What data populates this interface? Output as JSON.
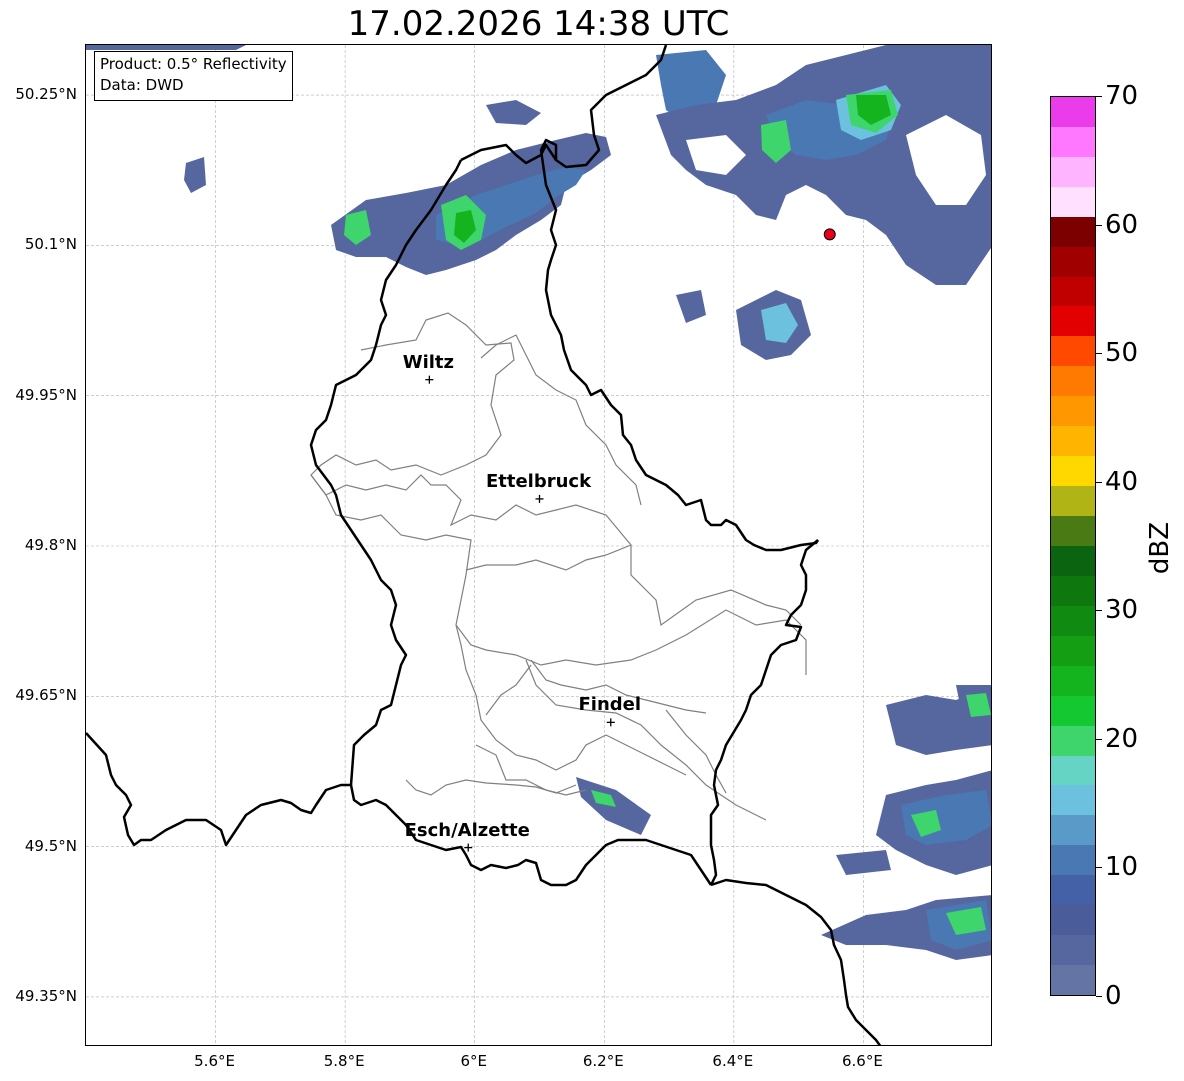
{
  "title": "17.02.2026 14:38 UTC",
  "info_box": {
    "product": "Product: 0.5° Reflectivity",
    "data": "Data: DWD"
  },
  "map": {
    "extent": {
      "lon_min": 5.4,
      "lon_max": 6.8,
      "lat_min": 49.3,
      "lat_max": 50.3
    },
    "lat_ticks": [
      {
        "value": 50.25,
        "label": "50.25°N"
      },
      {
        "value": 50.1,
        "label": "50.1°N"
      },
      {
        "value": 49.95,
        "label": "49.95°N"
      },
      {
        "value": 49.8,
        "label": "49.8°N"
      },
      {
        "value": 49.65,
        "label": "49.65°N"
      },
      {
        "value": 49.5,
        "label": "49.5°N"
      },
      {
        "value": 49.35,
        "label": "49.35°N"
      }
    ],
    "lon_ticks": [
      {
        "value": 5.6,
        "label": "5.6°E"
      },
      {
        "value": 5.8,
        "label": "5.8°E"
      },
      {
        "value": 6.0,
        "label": "6°E"
      },
      {
        "value": 6.2,
        "label": "6.2°E"
      },
      {
        "value": 6.4,
        "label": "6.4°E"
      },
      {
        "value": 6.6,
        "label": "6.6°E"
      }
    ],
    "cities": [
      {
        "name": "Wiltz",
        "lon": 5.93,
        "lat": 49.966
      },
      {
        "name": "Ettelbruck",
        "lon": 6.1,
        "lat": 49.847
      },
      {
        "name": "Findel",
        "lon": 6.21,
        "lat": 49.624
      },
      {
        "name": "Esch/Alzette",
        "lon": 5.99,
        "lat": 49.499
      }
    ],
    "radar_site": {
      "lon": 6.548,
      "lat": 50.111,
      "color": "#e8001a"
    },
    "border_color": "#000000",
    "canton_color": "#808080",
    "grid_color": "#b0b0b0"
  },
  "colorbar": {
    "label": "dBZ",
    "min": 0,
    "max": 70,
    "ticks": [
      {
        "value": 0,
        "label": "0"
      },
      {
        "value": 10,
        "label": "10"
      },
      {
        "value": 20,
        "label": "20"
      },
      {
        "value": 30,
        "label": "30"
      },
      {
        "value": 40,
        "label": "40"
      },
      {
        "value": 50,
        "label": "50"
      },
      {
        "value": 60,
        "label": "60"
      },
      {
        "value": 70,
        "label": "70"
      }
    ],
    "colors": [
      "#6474a4",
      "#56669e",
      "#4a5d9a",
      "#4460a6",
      "#4a78b2",
      "#5a9ac8",
      "#6cc2de",
      "#66d4c4",
      "#3ed66c",
      "#14c832",
      "#14b41e",
      "#149e14",
      "#108a10",
      "#0e780e",
      "#0a6410",
      "#4a7a14",
      "#b0b414",
      "#ffd800",
      "#ffb400",
      "#ff9800",
      "#ff7a00",
      "#ff4800",
      "#e20000",
      "#c00000",
      "#a00000",
      "#7c0000",
      "#ffe0ff",
      "#ffb4ff",
      "#ff78ff",
      "#ea3cea"
    ]
  },
  "precip_colors": {
    "very_light": "#56669e",
    "light": "#4a78b2",
    "moderate": "#6cc2de",
    "medium": "#3ed66c",
    "strong": "#14b41e"
  }
}
